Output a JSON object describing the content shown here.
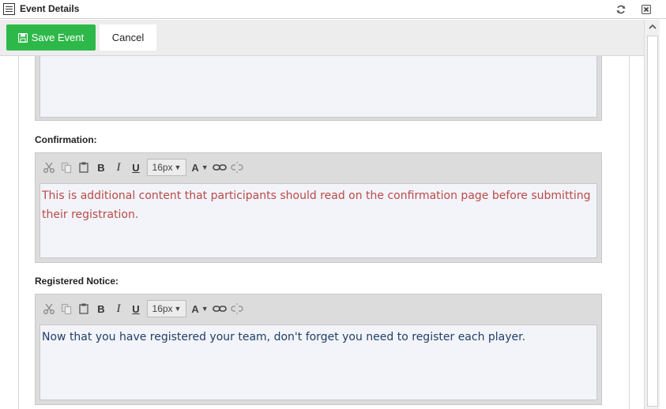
{
  "window": {
    "title": "Event Details"
  },
  "toolbar": {
    "save_label": "Save Event",
    "cancel_label": "Cancel"
  },
  "editors": [
    {
      "label": "",
      "content": ""
    },
    {
      "label": "Confirmation:",
      "font_size": "16px",
      "content": "This is additional content that participants should read on the confirmation page before submitting their registration.",
      "text_color": "#b94a48"
    },
    {
      "label": "Registered Notice:",
      "font_size": "16px",
      "content": "Now that you have registered your team, don't forget you need to register each player.",
      "text_color": "#1f3f66"
    }
  ],
  "colors": {
    "save_button": "#2eb84a",
    "toolbar_bg": "#ededed",
    "editor_frame": "#dcdcdc",
    "editor_area": "#f3f4f9"
  },
  "icons": {
    "title": "form-icon",
    "refresh": "refresh-icon",
    "close": "close-icon",
    "save": "floppy-disk-icon"
  }
}
